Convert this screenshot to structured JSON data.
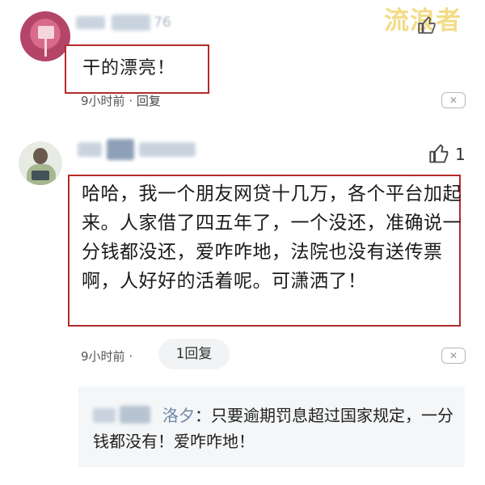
{
  "watermark": "流浪者",
  "comment1": {
    "username_visible": "76",
    "text": "干的漂亮！",
    "time": "9小时前",
    "separator": "·",
    "reply_label": "回复",
    "close_symbol": "✕",
    "like_icon": "thumbs-up-icon"
  },
  "comment2": {
    "text": "哈哈，我一个朋友网贷十几万，各个平台加起来。人家借了四五年了，一个没还，准确说一分钱都没还，爱咋咋地，法院也没有送传票啊，人好好的活着呢。可潇洒了！",
    "like_count": "1",
    "time": "9小时前",
    "separator": "·",
    "reply_pill": "1回复",
    "close_symbol": "✕",
    "like_icon": "thumbs-up-icon"
  },
  "reply": {
    "author_visible": "洛夕",
    "colon": "：",
    "text": "只要逾期罚息超过国家规定，一分钱都没有！爱咋咋地！"
  },
  "colors": {
    "highlight_border": "#b52a2a",
    "watermark": "#f3dc87",
    "reply_name": "#6f87a8"
  }
}
